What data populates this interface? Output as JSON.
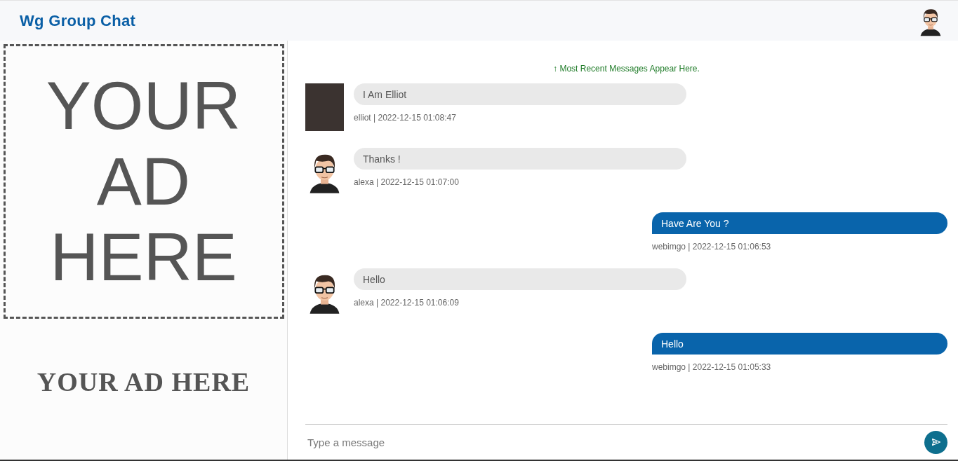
{
  "header": {
    "title": "Wg Group Chat",
    "user_avatar": {
      "kind": "cartoon"
    }
  },
  "ad": {
    "banner_lines": [
      "YOUR",
      "AD",
      "HERE"
    ],
    "caption": "YOUR AD HERE"
  },
  "chat": {
    "notice": "↑ Most Recent Messages Appear Here.",
    "messages": [
      {
        "kind": "incoming",
        "avatar": {
          "kind": "photo"
        },
        "text": "I Am Elliot",
        "meta": "elliot | 2022-12-15 01:08:47"
      },
      {
        "kind": "incoming",
        "avatar": {
          "kind": "cartoon"
        },
        "text": "Thanks !",
        "meta": "alexa | 2022-12-15 01:07:00"
      },
      {
        "kind": "outgoing",
        "text": "Have Are You ?",
        "meta": "webimgo | 2022-12-15 01:06:53"
      },
      {
        "kind": "incoming",
        "avatar": {
          "kind": "cartoon"
        },
        "text": "Hello",
        "meta": "alexa | 2022-12-15 01:06:09"
      },
      {
        "kind": "outgoing",
        "text": "Hello",
        "meta": "webimgo | 2022-12-15 01:05:33"
      }
    ]
  },
  "composer": {
    "placeholder": "Type a message"
  }
}
